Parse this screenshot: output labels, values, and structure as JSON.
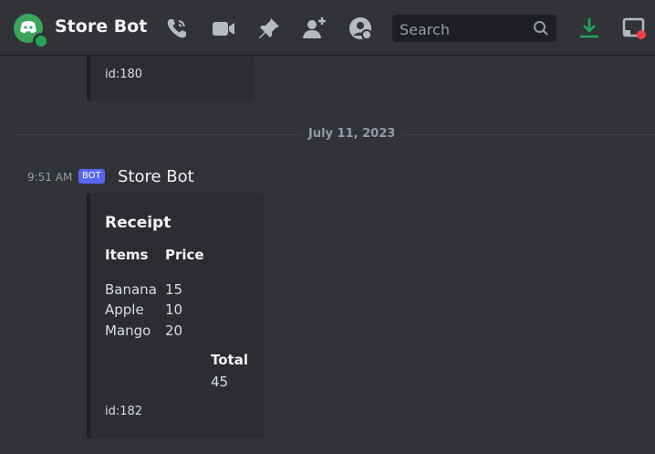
{
  "header": {
    "title": "Store Bot",
    "search_placeholder": "Search",
    "icons": [
      "discord-avatar",
      "call-icon",
      "video-icon",
      "pin-icon",
      "add-member-icon",
      "profile-icon",
      "search-icon",
      "download-icon",
      "screen-icon"
    ]
  },
  "messages": {
    "previous": {
      "id": "id:180"
    },
    "divider_date": "July 11, 2023",
    "current": {
      "time": "9:51 AM",
      "badge": "BOT",
      "author": "Store Bot",
      "embed": {
        "title": "Receipt",
        "fields": {
          "items": {
            "name": "Items",
            "lines": [
              "Banana",
              "Apple",
              "Mango"
            ]
          },
          "price": {
            "name": "Price",
            "lines": [
              "15",
              "10",
              "20"
            ]
          },
          "total": {
            "name": "Total",
            "value": "45"
          }
        },
        "footer_id": "id:182"
      }
    }
  },
  "colors": {
    "background": "#313338",
    "embed_bg": "#2b2d31",
    "bot_badge": "#5865f2",
    "avatar": "#3ba55c",
    "download": "#23a559",
    "notify_dot": "#f23f42"
  }
}
